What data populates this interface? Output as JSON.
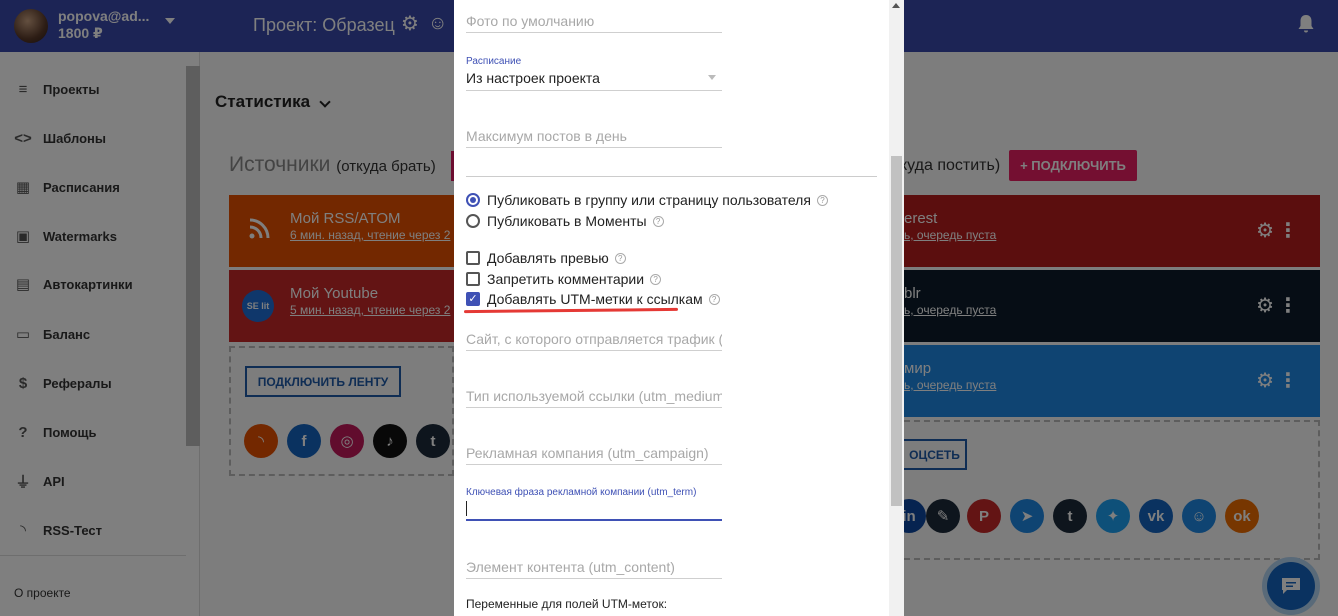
{
  "topbar": {
    "user_name": "popova@ad...",
    "user_balance": "1800 ₽",
    "project_title": "Проект: Образец"
  },
  "sidebar": {
    "items": [
      {
        "label": "Проекты",
        "icon": "list-icon"
      },
      {
        "label": "Шаблоны",
        "icon": "code-icon"
      },
      {
        "label": "Расписания",
        "icon": "calendar-icon"
      },
      {
        "label": "Watermarks",
        "icon": "image-frame-icon"
      },
      {
        "label": "Автокартинки",
        "icon": "gallery-icon"
      },
      {
        "label": "Баланс",
        "icon": "card-icon"
      },
      {
        "label": "Рефералы",
        "icon": "dollar-icon"
      },
      {
        "label": "Помощь",
        "icon": "help-icon"
      },
      {
        "label": "API",
        "icon": "plug-icon"
      },
      {
        "label": "RSS-Тест",
        "icon": "rss-icon"
      }
    ],
    "about": "О проекте"
  },
  "main": {
    "stats_title": "Статистика",
    "sources_title": "Источники",
    "sources_sub": "(откуда брать)",
    "dest_partial": "куда постить)",
    "connect_network_btn": "+ ПОДКЛЮЧИТЬ",
    "source_cards": [
      {
        "title": "Мой RSS/ATOM",
        "status": "6 мин. назад, чтение через 2"
      },
      {
        "title": "Мой Youtube",
        "status": "5 мин. назад, чтение через 2"
      }
    ],
    "dest_cards": [
      {
        "title": "erest",
        "status": "ь, очередь пуста"
      },
      {
        "title": "blr",
        "status": "ь, очередь пуста"
      },
      {
        "title": "мир",
        "status": "ь, очередь пуста"
      }
    ],
    "connect_feed_btn": "ПОДКЛЮЧИТЬ ЛЕНТУ",
    "connect_net2_btn": "ОЦСЕТЬ",
    "yt_badge": "SE lit"
  },
  "modal": {
    "photo_default_placeholder": "Фото по умолчанию",
    "schedule_label": "Расписание",
    "schedule_value": "Из настроек проекта",
    "max_posts_placeholder": "Максимум постов в день",
    "publish_options": [
      {
        "label": "Публиковать в группу или страницу пользователя",
        "selected": true
      },
      {
        "label": "Публиковать в Моменты",
        "selected": false
      }
    ],
    "checkboxes": [
      {
        "label": "Добавлять превью",
        "checked": false
      },
      {
        "label": "Запретить комментарии",
        "checked": false
      },
      {
        "label": "Добавлять UTM-метки к ссылкам",
        "checked": true
      }
    ],
    "utm_source_placeholder": "Сайт, с которого отправляется трафик (utm_source)",
    "utm_medium_placeholder": "Тип используемой ссылки (utm_medium)",
    "utm_campaign_placeholder": "Рекламная компания (utm_campaign)",
    "utm_term_label": "Ключевая фраза рекламной компании (utm_term)",
    "utm_term_value": "",
    "utm_content_placeholder": "Элемент контента (utm_content)",
    "vars_label": "Переменные для полей UTM-меток:"
  },
  "colors": {
    "topbar": "#3949ab",
    "accent": "#3f51b5",
    "pink": "#e91e63",
    "underline_red": "#e53935"
  }
}
